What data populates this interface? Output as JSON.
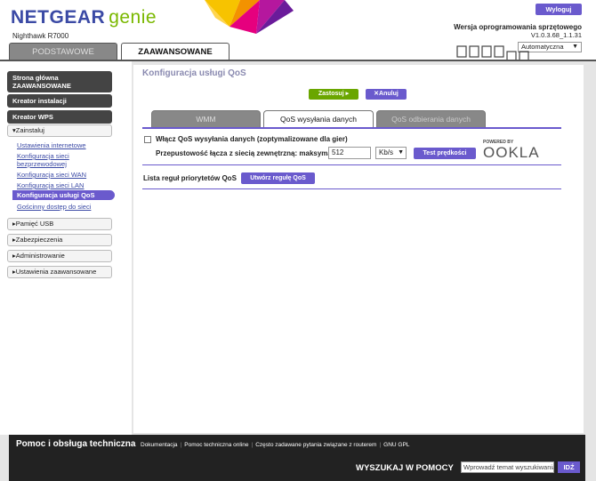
{
  "header": {
    "logo_brand": "NETGEAR",
    "logo_product": "genie",
    "model": "Nighthawk R7000",
    "logout_label": "Wyloguj",
    "firmware_label": "Wersja oprogramowania sprzętowego",
    "firmware_version": "V1.0.3.68_1.1.31",
    "language_selected": "Automatyczna"
  },
  "main_tabs": {
    "basic": "PODSTAWOWE",
    "advanced": "ZAAWANSOWANE"
  },
  "sidebar": {
    "home_line1": "Strona główna",
    "home_line2": "ZAAWANSOWANE",
    "setup_wizard": "Kreator instalacji",
    "wps_wizard": "Kreator WPS",
    "setup": "Zainstaluj",
    "setup_items": [
      "Ustawienia internetowe",
      "Konfiguracja sieci",
      "bezprzewodowej",
      "Konfiguracja sieci WAN",
      "Konfiguracja sieci LAN",
      "Konfiguracja usługi QoS",
      "Gościnny dostęp do sieci"
    ],
    "usb_storage": "Pamięć USB",
    "security": "Zabezpieczenia",
    "administration": "Administrowanie",
    "advanced_setup": "Ustawienia zaawansowane"
  },
  "content": {
    "title": "Konfiguracja usługi QoS",
    "apply_label": "Zastosuj",
    "cancel_label": "Anuluj",
    "tabs": {
      "wmm": "WMM",
      "upstream": "QoS wysyłania danych",
      "downstream": "QoS odbierania danych"
    },
    "enable_label": "Włącz QoS wysyłania danych (zoptymalizowane dla gier)",
    "bandwidth_label": "Przepustowość łącza z siecią zewnętrzną: maksymalna",
    "bandwidth_value": "512",
    "bandwidth_unit": "Kb/s",
    "speedtest_label": "Test prędkości",
    "ookla_powered": "POWERED BY",
    "ookla_name": "OOKLA",
    "rules_label": "Lista reguł priorytetów QoS",
    "create_rule_label": "Utwórz regułę QoS"
  },
  "footer": {
    "title": "Pomoc i obsługa techniczna",
    "links": [
      "Dokumentacja",
      "Pomoc techniczna online",
      "Często zadawane pytania związane z routerem",
      "GNU GPL"
    ],
    "search_label": "WYSZUKAJ W POMOCY",
    "search_placeholder": "Wprowadź temat wyszukiwania",
    "go_label": "IDŹ"
  },
  "colors": {
    "accent": "#6a5acd",
    "apply_green": "#6aa600",
    "netgear_blue": "#3b4aa5",
    "genie_green": "#7ab800"
  }
}
